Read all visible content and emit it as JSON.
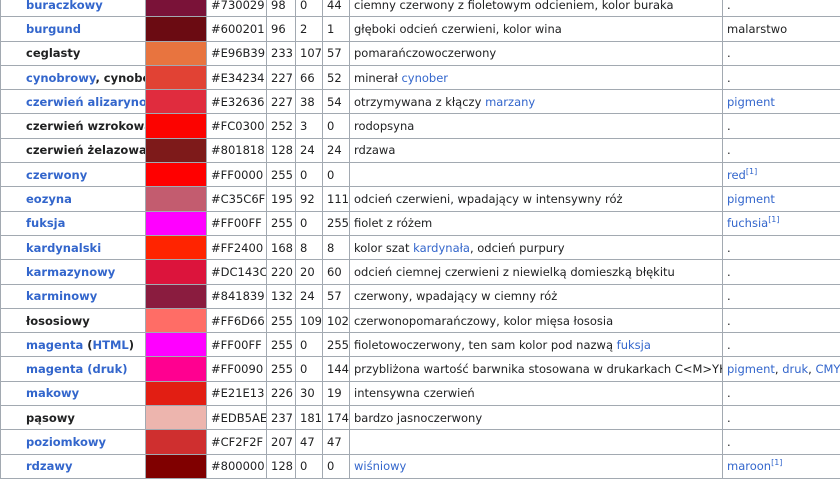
{
  "rows": [
    {
      "name": [
        {
          "t": "buraczkowy",
          "link": true
        }
      ],
      "hex": "#730029",
      "r": "98",
      "g": "0",
      "b": "44",
      "desc": [
        {
          "t": "ciemny czerwony z fioletowym odcieniem, kolor buraka"
        }
      ],
      "extra": [
        {
          "t": "."
        }
      ]
    },
    {
      "name": [
        {
          "t": "burgund",
          "link": true
        }
      ],
      "hex": "#600201",
      "r": "96",
      "g": "2",
      "b": "1",
      "desc": [
        {
          "t": "głęboki odcień czerwieni, kolor wina"
        }
      ],
      "extra": [
        {
          "t": "malarstwo"
        }
      ]
    },
    {
      "name": [
        {
          "t": "ceglasty"
        }
      ],
      "hex": "#E96B39",
      "r": "233",
      "g": "107",
      "b": "57",
      "desc": [
        {
          "t": "pomarańczowoczerwony"
        }
      ],
      "extra": [
        {
          "t": "."
        }
      ]
    },
    {
      "name": [
        {
          "t": "cynobrowy",
          "link": true
        },
        {
          "t": ", cynober"
        }
      ],
      "hex": "#E34234",
      "r": "227",
      "g": "66",
      "b": "52",
      "desc": [
        {
          "t": "minerał "
        },
        {
          "t": "cynober",
          "link": true
        }
      ],
      "extra": [
        {
          "t": "."
        }
      ]
    },
    {
      "name": [
        {
          "t": "czerwień alizarynowa",
          "link": true
        }
      ],
      "hex": "#E32636",
      "r": "227",
      "g": "38",
      "b": "54",
      "desc": [
        {
          "t": "otrzymywana z kłączy "
        },
        {
          "t": "marzany",
          "link": true
        }
      ],
      "extra": [
        {
          "t": "pigment",
          "link": true
        }
      ]
    },
    {
      "name": [
        {
          "t": "czerwień wzrokowa"
        }
      ],
      "hex": "#FC0300",
      "r": "252",
      "g": "3",
      "b": "0",
      "desc": [
        {
          "t": "rodopsyna"
        }
      ],
      "extra": [
        {
          "t": "."
        }
      ]
    },
    {
      "name": [
        {
          "t": "czerwień żelazowa"
        }
      ],
      "hex": "#801818",
      "r": "128",
      "g": "24",
      "b": "24",
      "desc": [
        {
          "t": "rdzawa"
        }
      ],
      "extra": [
        {
          "t": "."
        }
      ]
    },
    {
      "name": [
        {
          "t": "czerwony",
          "link": true
        }
      ],
      "hex": "#FF0000",
      "r": "255",
      "g": "0",
      "b": "0",
      "desc": [],
      "extra": [
        {
          "t": "red",
          "link": true
        },
        {
          "t": "[1]",
          "link": true,
          "sup": true
        }
      ]
    },
    {
      "name": [
        {
          "t": "eozyna",
          "link": true
        }
      ],
      "hex": "#C35C6F",
      "r": "195",
      "g": "92",
      "b": "111",
      "desc": [
        {
          "t": "odcień czerwieni, wpadający w intensywny róż"
        }
      ],
      "extra": [
        {
          "t": "pigment",
          "link": true
        }
      ]
    },
    {
      "name": [
        {
          "t": "fuksja",
          "link": true
        }
      ],
      "hex": "#FF00FF",
      "r": "255",
      "g": "0",
      "b": "255",
      "desc": [
        {
          "t": "fiolet z różem"
        }
      ],
      "extra": [
        {
          "t": "fuchsia",
          "link": true
        },
        {
          "t": "[1]",
          "link": true,
          "sup": true
        }
      ]
    },
    {
      "name": [
        {
          "t": "kardynalski",
          "link": true
        }
      ],
      "hex": "#FF2400",
      "r": "168",
      "g": "8",
      "b": "8",
      "desc": [
        {
          "t": "kolor szat "
        },
        {
          "t": "kardynała",
          "link": true
        },
        {
          "t": ", odcień purpury"
        }
      ],
      "extra": [
        {
          "t": "."
        }
      ]
    },
    {
      "name": [
        {
          "t": "karmazynowy",
          "link": true
        }
      ],
      "hex": "#DC143C",
      "r": "220",
      "g": "20",
      "b": "60",
      "desc": [
        {
          "t": "odcień ciemnej czerwieni z niewielką domieszką błękitu"
        }
      ],
      "extra": [
        {
          "t": "."
        }
      ]
    },
    {
      "name": [
        {
          "t": "karminowy",
          "link": true
        }
      ],
      "hex": "#841839",
      "r": "132",
      "g": "24",
      "b": "57",
      "desc": [
        {
          "t": "czerwony, wpadający w ciemny róż"
        }
      ],
      "extra": [
        {
          "t": "."
        }
      ]
    },
    {
      "name": [
        {
          "t": "łososiowy"
        }
      ],
      "hex": "#FF6D66",
      "r": "255",
      "g": "109",
      "b": "102",
      "desc": [
        {
          "t": "czerwonopomarańczowy, kolor mięsa łososia"
        }
      ],
      "extra": [
        {
          "t": "."
        }
      ]
    },
    {
      "name": [
        {
          "t": "magenta",
          "link": true
        },
        {
          "t": " ("
        },
        {
          "t": "HTML",
          "link": true
        },
        {
          "t": ")"
        }
      ],
      "hex": "#FF00FF",
      "r": "255",
      "g": "0",
      "b": "255",
      "desc": [
        {
          "t": "fioletowoczerwony, ten sam kolor pod nazwą "
        },
        {
          "t": "fuksja",
          "link": true
        }
      ],
      "extra": [
        {
          "t": "."
        }
      ]
    },
    {
      "name": [
        {
          "t": "magenta (druk)",
          "link": true
        }
      ],
      "hex": "#FF0090",
      "r": "255",
      "g": "0",
      "b": "144",
      "desc": [
        {
          "t": "przybliżona wartość barwnika stosowana w drukarkach C<M>YK"
        }
      ],
      "extra": [
        {
          "t": "pigment",
          "link": true
        },
        {
          "t": ", "
        },
        {
          "t": "druk",
          "link": true
        },
        {
          "t": ", "
        },
        {
          "t": "CMYK",
          "link": true
        }
      ]
    },
    {
      "name": [
        {
          "t": "makowy",
          "link": true
        }
      ],
      "hex": "#E21E13",
      "r": "226",
      "g": "30",
      "b": "19",
      "desc": [
        {
          "t": "intensywna czerwień"
        }
      ],
      "extra": [
        {
          "t": "."
        }
      ]
    },
    {
      "name": [
        {
          "t": "pąsowy"
        }
      ],
      "hex": "#EDB5AE",
      "r": "237",
      "g": "181",
      "b": "174",
      "desc": [
        {
          "t": "bardzo jasnoczerwony"
        }
      ],
      "extra": [
        {
          "t": "."
        }
      ]
    },
    {
      "name": [
        {
          "t": "poziomkowy",
          "link": true
        }
      ],
      "hex": "#CF2F2F",
      "r": "207",
      "g": "47",
      "b": "47",
      "desc": [],
      "extra": [
        {
          "t": "."
        }
      ]
    },
    {
      "name": [
        {
          "t": "rdzawy",
          "link": true
        }
      ],
      "hex": "#800000",
      "r": "128",
      "g": "0",
      "b": "0",
      "desc": [
        {
          "t": "wiśniowy",
          "link": true
        }
      ],
      "extra": [
        {
          "t": "maroon",
          "link": true
        },
        {
          "t": "[1]",
          "link": true,
          "sup": true
        }
      ]
    }
  ],
  "swatches": [
    "#7A1238",
    "#6B0B12",
    "#E8743F",
    "#E14234",
    "#E02C3E",
    "#FC0300",
    "#7E1A1A",
    "#FF0000",
    "#C35C6F",
    "#FF00FF",
    "#FF2400",
    "#DC143C",
    "#8A1C3F",
    "#FF6D66",
    "#FF00FF",
    "#FF0090",
    "#E21E13",
    "#EDB5AE",
    "#CF2F2F",
    "#800000"
  ],
  "colors": {
    "link": "#3366cc",
    "text": "#202122",
    "border": "#a2a9b1"
  }
}
